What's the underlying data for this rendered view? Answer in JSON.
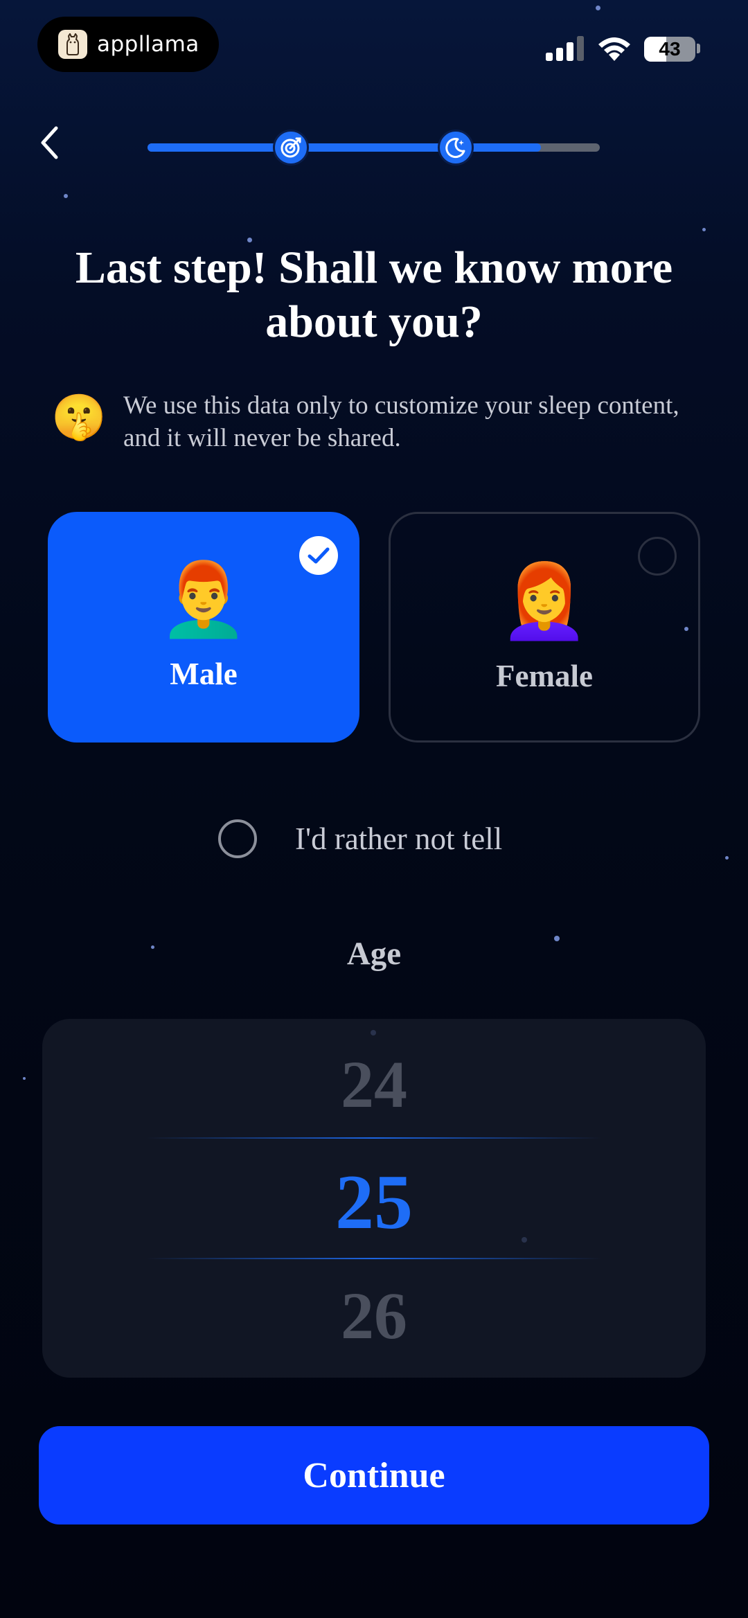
{
  "status_bar": {
    "app_name": "appllama",
    "battery_level": 43,
    "battery_text": "43",
    "icons": [
      "cellular-signal-icon",
      "wifi-icon",
      "battery-icon"
    ]
  },
  "navigation": {
    "back_icon": "chevron-left-icon",
    "progress": 0.87,
    "step_icons": [
      "target-icon",
      "moon-star-icon"
    ]
  },
  "header": {
    "title": "Last step! Shall we know more about you?",
    "notice_emoji": "🤫",
    "notice_text": "We use this data only to customize your sleep content, and it will never be shared."
  },
  "gender": {
    "options": [
      {
        "label": "Male",
        "emoji": "👨‍🦰",
        "selected": true
      },
      {
        "label": "Female",
        "emoji": "👩‍🦰",
        "selected": false
      }
    ],
    "prefer_not_label": "I'd rather not tell"
  },
  "age": {
    "label": "Age",
    "previous": "24",
    "selected": "25",
    "next": "26"
  },
  "footer": {
    "continue_label": "Continue"
  },
  "colors": {
    "accent": "#1E6DF6",
    "button": "#0A3CFF",
    "background": "#020818"
  }
}
